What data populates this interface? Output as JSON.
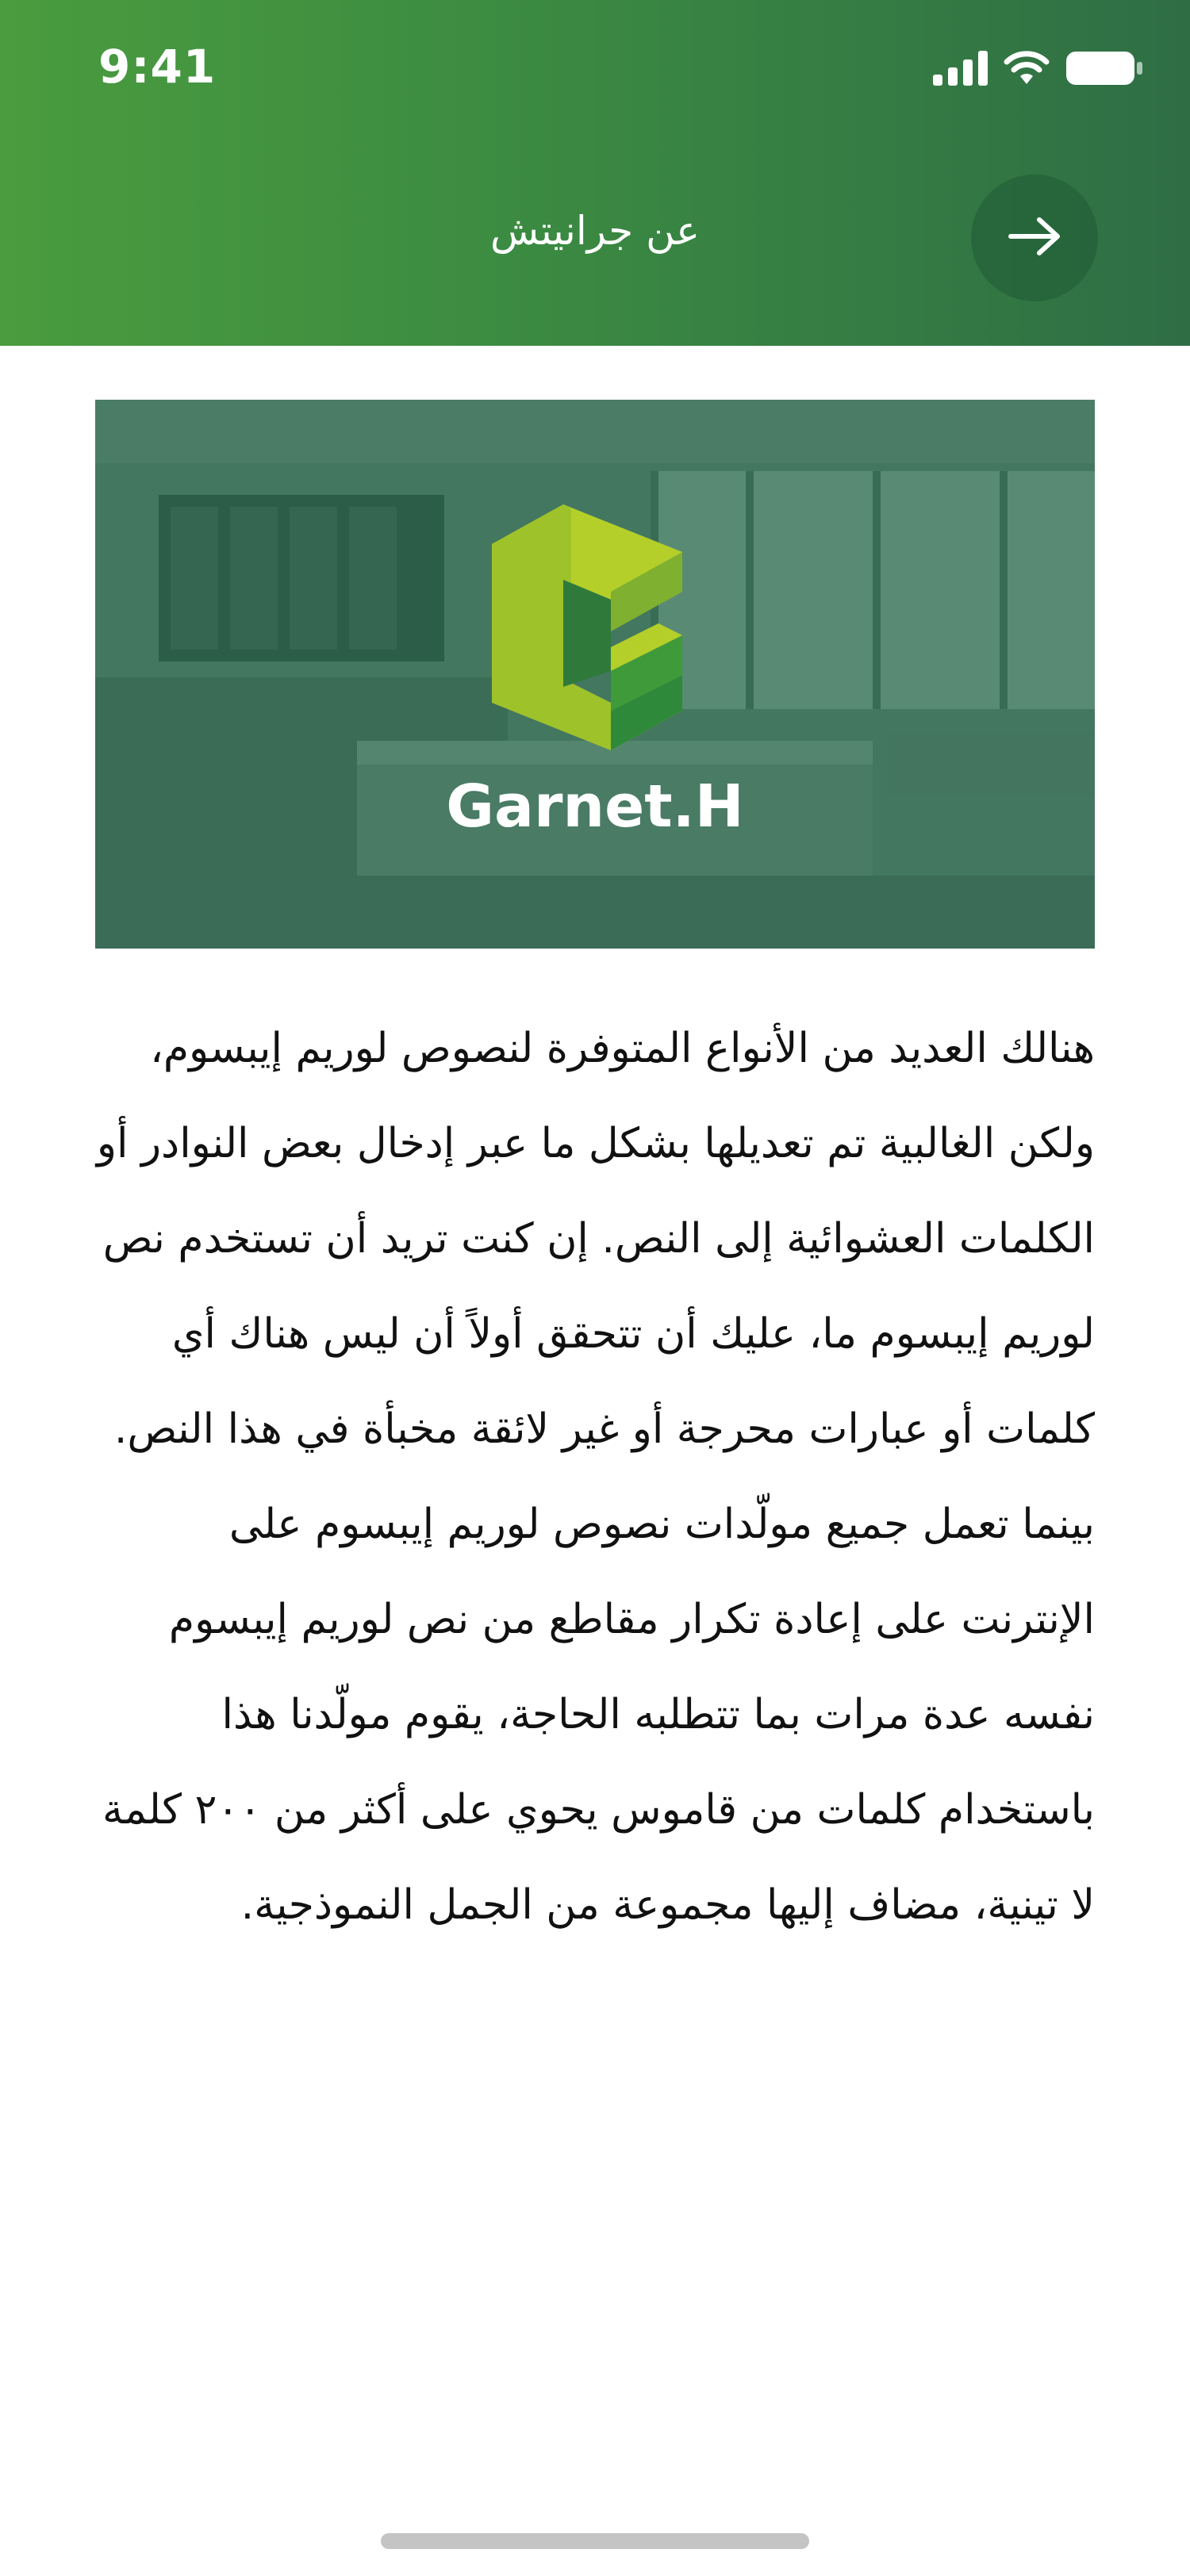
{
  "status_bar": {
    "time": "9:41",
    "icons": [
      "signal-icon",
      "wifi-icon",
      "battery-icon"
    ]
  },
  "header": {
    "title": "عن جرانيتش",
    "back_icon": "arrow-right-icon"
  },
  "hero": {
    "brand_name": "Garnet.H",
    "logo_icon": "g-cube-logo-icon"
  },
  "content": {
    "paragraph": "هنالك العديد من الأنواع المتوفرة لنصوص لوريم إيبسوم، ولكن الغالبية تم تعديلها بشكل ما عبر إدخال بعض النوادر أو الكلمات العشوائية إلى النص. إن كنت تريد أن تستخدم نص لوريم إيبسوم ما، عليك أن تتحقق أولاً أن ليس هناك أي كلمات أو عبارات محرجة أو غير لائقة مخبأة في هذا النص. بينما تعمل جميع مولّدات نصوص لوريم إيبسوم على الإنترنت على إعادة تكرار مقاطع من نص لوريم إيبسوم نفسه عدة مرات بما تتطلبه الحاجة، يقوم مولّدنا هذا باستخدام كلمات من قاموس يحوي على أكثر من ٢٠٠ كلمة لا تينية، مضاف إليها مجموعة من الجمل النموذجية."
  },
  "colors": {
    "header_start": "#4a9c3e",
    "header_end": "#2f6e45",
    "text": "#111111",
    "logo_lime": "#b5cf2a",
    "logo_green": "#3f9a3a"
  }
}
